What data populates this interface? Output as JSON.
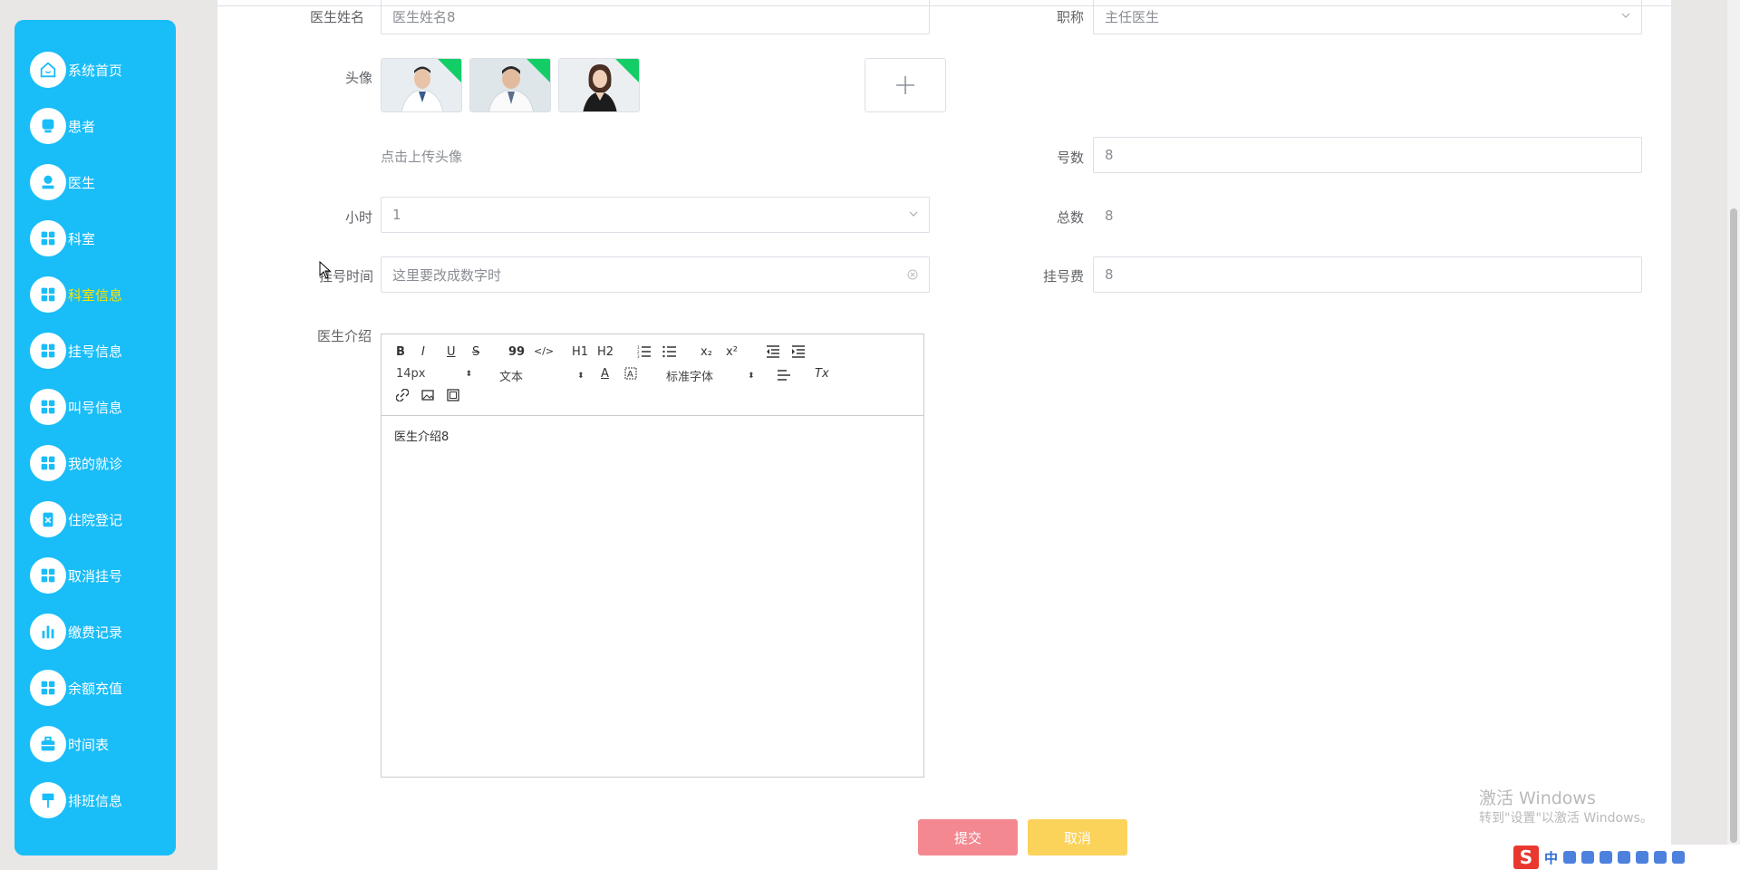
{
  "sidebar": {
    "items": [
      {
        "label": "系统首页",
        "icon": "home-icon"
      },
      {
        "label": "患者",
        "icon": "monitor-icon"
      },
      {
        "label": "医生",
        "icon": "user-stamp-icon"
      },
      {
        "label": "科室",
        "icon": "grid-icon"
      },
      {
        "label": "科室信息",
        "icon": "grid-icon",
        "active": true
      },
      {
        "label": "挂号信息",
        "icon": "grid-icon"
      },
      {
        "label": "叫号信息",
        "icon": "grid-icon"
      },
      {
        "label": "我的就诊",
        "icon": "grid-icon"
      },
      {
        "label": "住院登记",
        "icon": "clipboard-icon"
      },
      {
        "label": "取消挂号",
        "icon": "grid-icon"
      },
      {
        "label": "缴费记录",
        "icon": "bar-chart-icon"
      },
      {
        "label": "余额充值",
        "icon": "grid-icon"
      },
      {
        "label": "时间表",
        "icon": "briefcase-icon"
      },
      {
        "label": "排班信息",
        "icon": "pin-icon"
      }
    ],
    "accent_color": "#19bdf8",
    "active_color": "#ffe100"
  },
  "form": {
    "doctor_name": {
      "label": "医生姓名",
      "value": "医生姓名8"
    },
    "title": {
      "label": "职称",
      "value": "主任医生"
    },
    "avatar": {
      "label": "头像",
      "hint": "点击上传头像"
    },
    "number": {
      "label": "号数",
      "value": "8"
    },
    "hour": {
      "label": "小时",
      "value": "1"
    },
    "total": {
      "label": "总数",
      "value": "8"
    },
    "reg_time": {
      "label": "挂号时间",
      "value": "这里要改成数字时"
    },
    "reg_fee": {
      "label": "挂号费",
      "value": "8"
    },
    "intro": {
      "label": "医生介绍",
      "content": "医生介绍8"
    }
  },
  "editor": {
    "font_size": "14px",
    "text_type": "文本",
    "font_family": "标准字体",
    "tools": {
      "bold": "B",
      "italic": "I",
      "underline": "U",
      "strike": "S",
      "quote": "99",
      "code": "</>",
      "h1": "H1",
      "h2": "H2",
      "sub": "x₂",
      "sup": "x²",
      "color": "A",
      "clear": "Tx"
    }
  },
  "buttons": {
    "submit": "提交",
    "cancel": "取消"
  },
  "watermark": {
    "line1": "激活 Windows",
    "line2": "转到\"设置\"以激活 Windows。"
  },
  "ime": {
    "logo": "S",
    "lang": "中"
  }
}
